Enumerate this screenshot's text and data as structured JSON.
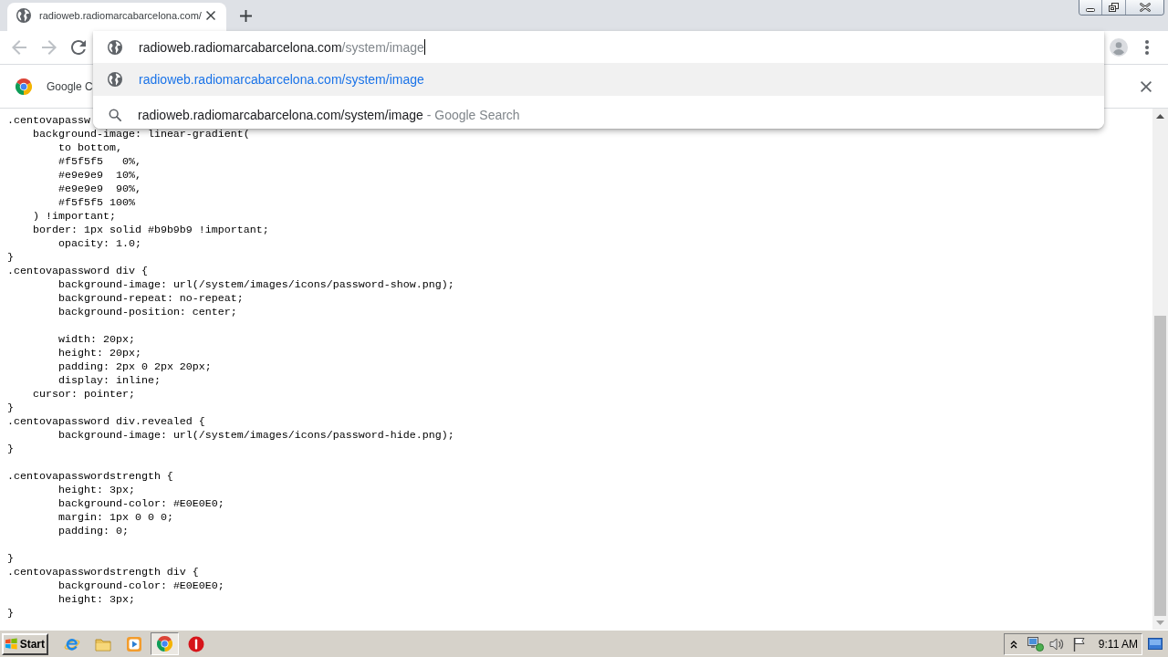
{
  "tabs": [
    {
      "title": "radioweb.radiomarcabarcelona.com/",
      "selected": true
    }
  ],
  "toolbar": {
    "back": {
      "disabled": true
    },
    "forward": {
      "disabled": true
    }
  },
  "omnibox": {
    "value": "radioweb.radiomarcabarcelona.com",
    "autocomplete": "/system/image",
    "suggestions": [
      {
        "kind": "url",
        "text": "radioweb.radiomarcabarcelona.com/system/image",
        "selected": true
      },
      {
        "kind": "search",
        "text": "radioweb.radiomarcabarcelona.com/system/image",
        "description": "- Google Search",
        "selected": false
      }
    ]
  },
  "infobar": {
    "message": "Google C"
  },
  "code_blocks": [
    [
      ".centovapassw",
      "    background-image: linear-gradient(",
      "        to bottom,",
      "        #f5f5f5   0%,",
      "        #e9e9e9  10%,",
      "        #e9e9e9  90%,",
      "        #f5f5f5 100%",
      "    ) !important;",
      "    border: 1px solid #b9b9b9 !important;",
      "        opacity: 1.0;",
      "}",
      ".centovapassword div {",
      "        background-image: url(/system/images/icons/password-show.png);",
      "        background-repeat: no-repeat;",
      "        background-position: center;"
    ],
    [
      "        width: 20px;",
      "        height: 20px;",
      "        padding: 2px 0 2px 20px;",
      "        display: inline;",
      "    cursor: pointer;",
      "}",
      ".centovapassword div.revealed {",
      "        background-image: url(/system/images/icons/password-hide.png);",
      "}"
    ],
    [
      ".centovapasswordstrength {",
      "        height: 3px;",
      "        background-color: #E0E0E0;",
      "        margin: 1px 0 0 0;",
      "        padding: 0;"
    ],
    [
      "}",
      ".centovapasswordstrength div {",
      "        background-color: #E0E0E0;",
      "        height: 3px;",
      "}"
    ]
  ],
  "taskbar": {
    "start": "Start",
    "apps": [
      {
        "kind": "ie",
        "selected": false
      },
      {
        "kind": "folder",
        "selected": false
      },
      {
        "kind": "media",
        "selected": false
      },
      {
        "kind": "chrome",
        "selected": true
      },
      {
        "kind": "alert",
        "selected": false
      }
    ],
    "clock": "9:11 AM"
  }
}
